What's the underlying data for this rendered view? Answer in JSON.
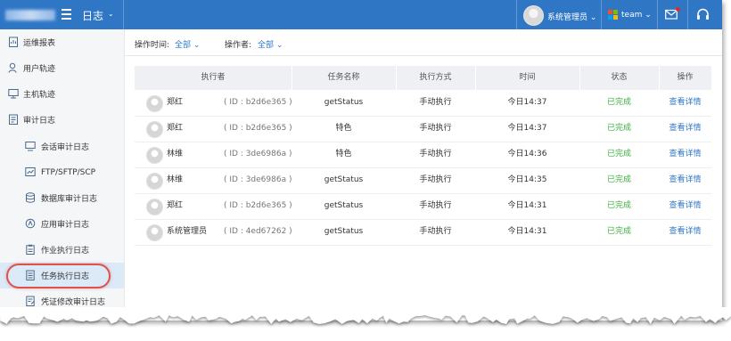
{
  "header": {
    "module_title": "日志",
    "user_name": "系统管理员",
    "team_name": "team"
  },
  "sidebar": {
    "items": [
      {
        "label": "运维报表",
        "icon": "report-icon"
      },
      {
        "label": "用户轨迹",
        "icon": "user-track-icon"
      },
      {
        "label": "主机轨迹",
        "icon": "host-track-icon"
      },
      {
        "label": "审计日志",
        "icon": "audit-log-icon"
      },
      {
        "label": "会话审计日志",
        "icon": "session-monitor-icon"
      },
      {
        "label": "FTP/SFTP/SCP",
        "icon": "ftp-icon"
      },
      {
        "label": "数据库审计日志",
        "icon": "database-icon"
      },
      {
        "label": "应用审计日志",
        "icon": "app-icon"
      },
      {
        "label": "作业执行日志",
        "icon": "job-clipboard-icon"
      },
      {
        "label": "任务执行日志",
        "icon": "task-doc-icon"
      },
      {
        "label": "凭证修改审计日志",
        "icon": "credential-doc-icon"
      }
    ],
    "active_index": 9
  },
  "filters": {
    "time_label": "操作时间:",
    "time_value": "全部",
    "operator_label": "操作者:",
    "operator_value": "全部"
  },
  "table": {
    "headers": [
      "执行者",
      "任务名称",
      "执行方式",
      "时间",
      "状态",
      "操作"
    ],
    "rows": [
      {
        "executor": "郑红",
        "id": "( ID : b2d6e365 )",
        "task": "getStatus",
        "method": "手动执行",
        "time": "今日14:37",
        "status": "已完成",
        "action": "查看详情"
      },
      {
        "executor": "郑红",
        "id": "( ID : b2d6e365 )",
        "task": "特色",
        "method": "手动执行",
        "time": "今日14:37",
        "status": "已完成",
        "action": "查看详情"
      },
      {
        "executor": "林维",
        "id": "( ID : 3de6986a )",
        "task": "特色",
        "method": "手动执行",
        "time": "今日14:36",
        "status": "已完成",
        "action": "查看详情"
      },
      {
        "executor": "林维",
        "id": "( ID : 3de6986a )",
        "task": "getStatus",
        "method": "手动执行",
        "time": "今日14:35",
        "status": "已完成",
        "action": "查看详情"
      },
      {
        "executor": "郑红",
        "id": "( ID : b2d6e365 )",
        "task": "getStatus",
        "method": "手动执行",
        "time": "今日14:31",
        "status": "已完成",
        "action": "查看详情"
      },
      {
        "executor": "系统管理员",
        "id": "( ID : 4ed67262 )",
        "task": "getStatus",
        "method": "手动执行",
        "time": "今日14:31",
        "status": "已完成",
        "action": "查看详情"
      }
    ]
  },
  "colors": {
    "topbar": "#2f77c5",
    "status_done": "#3fae3f",
    "link": "#2f77c5",
    "highlight": "#d9534f"
  }
}
